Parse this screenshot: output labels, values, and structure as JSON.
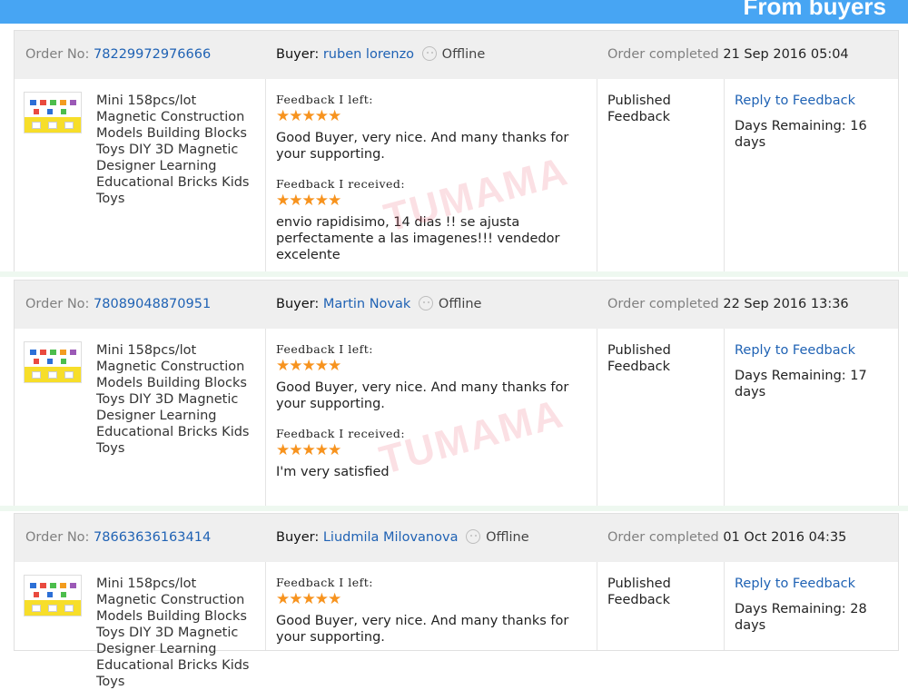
{
  "banner": {
    "title": "From buyers",
    "bg": "#47a5f3"
  },
  "labels": {
    "order_no": "Order No:",
    "buyer": "Buyer:",
    "order_completed": "Order completed",
    "feedback_left": "Feedback I left:",
    "feedback_received": "Feedback I received:",
    "published": "Published",
    "feedback": "Feedback",
    "reply": "Reply to Feedback",
    "offline": "Offline",
    "stars": "★★★★★"
  },
  "watermark": "TUMAMA",
  "orders": [
    {
      "order_no": "78229972976666",
      "buyer": "ruben lorenzo",
      "completed": "21 Sep 2016 05:04",
      "product": "Mini 158pcs/lot Magnetic Construction Models Building Blocks Toys DIY 3D Magnetic Designer Learning Educational Bricks Kids Toys",
      "left_text": "Good Buyer, very nice. And many thanks for your supporting.",
      "received_text": "envio rapidisimo, 14 dias !! se ajusta perfectamente a las imagenes!!! vendedor excelente",
      "days": "Days Remaining: 16 days"
    },
    {
      "order_no": "78089048870951",
      "buyer": "Martin Novak",
      "completed": "22 Sep 2016 13:36",
      "product": "Mini 158pcs/lot Magnetic Construction Models Building Blocks Toys DIY 3D Magnetic Designer Learning Educational Bricks Kids Toys",
      "left_text": "Good Buyer, very nice. And many thanks for your supporting.",
      "received_text": "I'm very satisfied",
      "days": "Days Remaining: 17 days"
    },
    {
      "order_no": "78663636163414",
      "buyer": "Liudmila Milovanova",
      "completed": "01 Oct 2016 04:35",
      "product": "Mini 158pcs/lot Magnetic Construction Models Building Blocks Toys DIY 3D Magnetic Designer Learning Educational Bricks Kids Toys",
      "left_text": "Good Buyer, very nice. And many thanks for your supporting.",
      "received_text": "",
      "days": "Days Remaining: 28 days"
    }
  ]
}
